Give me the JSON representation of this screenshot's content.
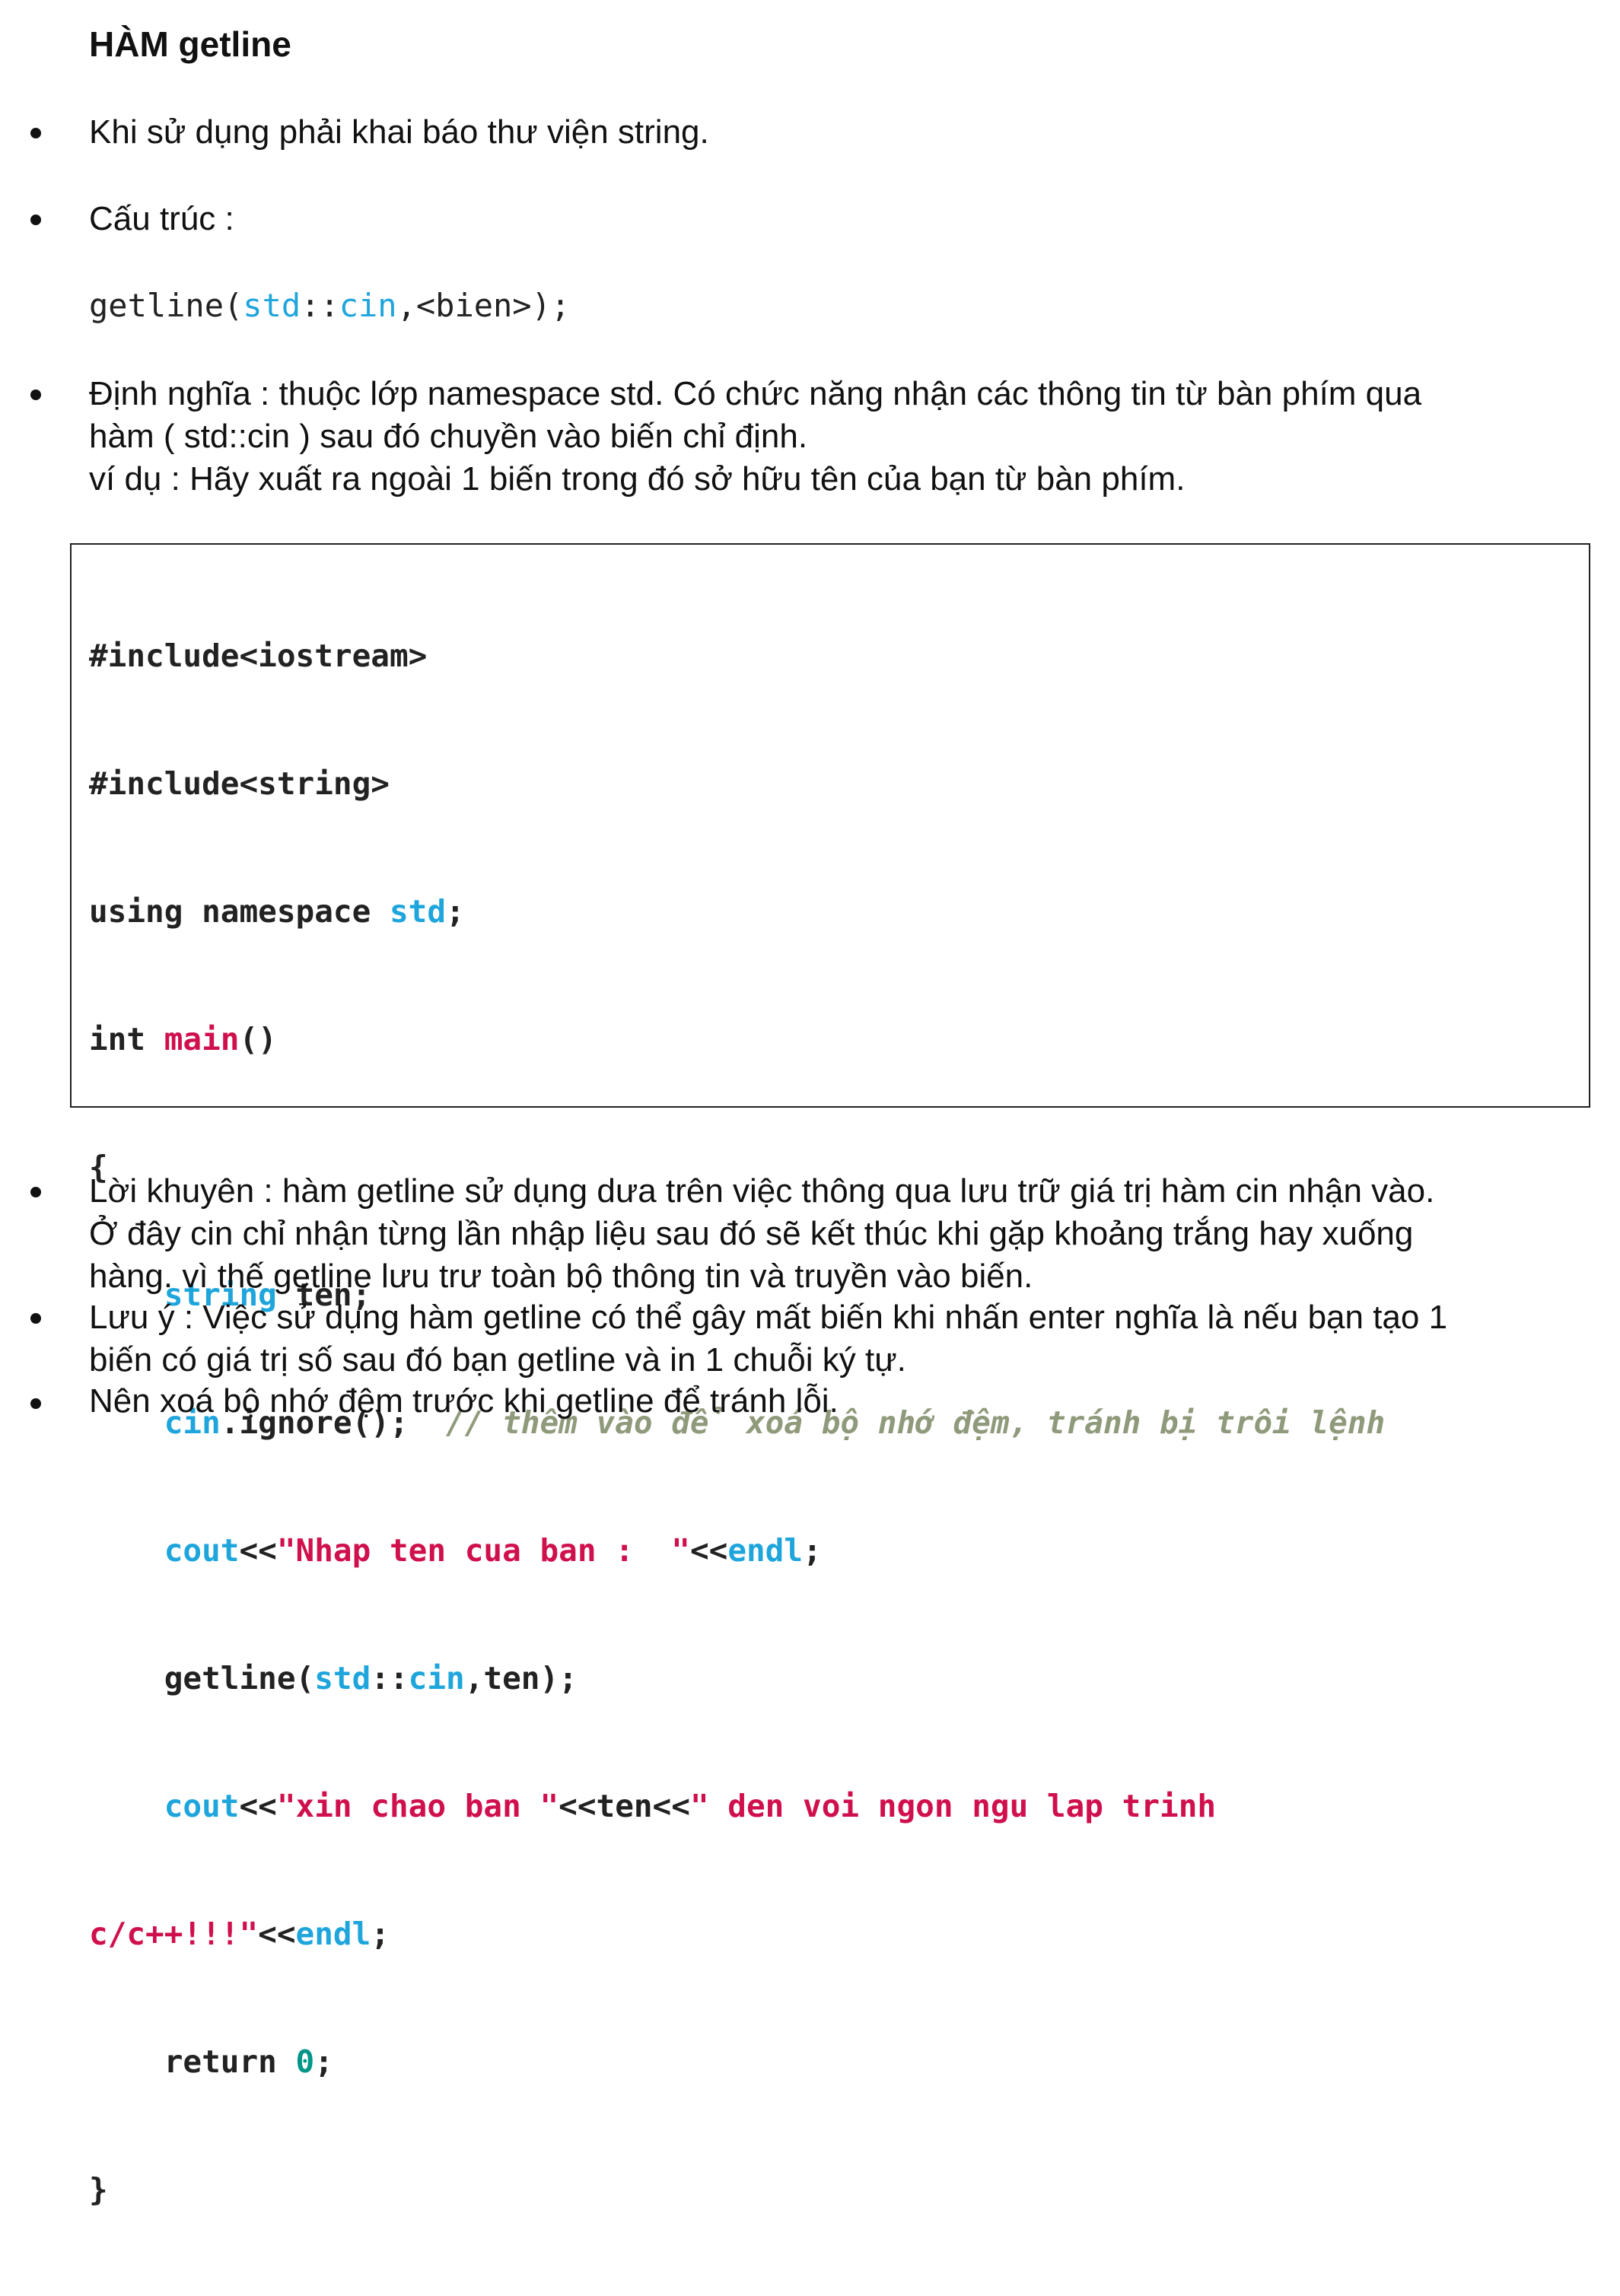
{
  "title": "HÀM getline",
  "bullets": {
    "b1": "Khi sử dụng phải khai báo thư viện string.",
    "b2": "Cấu trúc :",
    "b3_lines": [
      "Định nghĩa : thuộc lớp namespace std. Có chức năng nhận các thông tin từ bàn phím qua",
      "hàm ( std::cin ) sau đó chuyền vào biến chỉ định.",
      "ví dụ : Hãy xuất ra ngoài 1 biến trong đó sở hữu tên của bạn từ bàn phím."
    ],
    "b4_lines": [
      "Lời khuyên : hàm getline sử dụng dưa trên việc thông qua lưu trữ giá trị hàm cin nhận vào.",
      "Ở đây cin chỉ nhận từng lần nhập liệu sau đó sẽ kết thúc khi gặp khoảng trắng hay xuống",
      "hàng. vì thế getline lưu trư toàn bộ thông tin và truyền vào biến."
    ],
    "b5_lines": [
      "Lưu ý : Việc sử dụng hàm getline có thể gây mất biến khi nhấn enter nghĩa là nếu bạn tạo 1",
      "biến có giá trị số sau đó bạn getline và in 1 chuỗi ký tự."
    ],
    "b6": "Nên xoá bộ nhớ đệm trước khi getline để tránh lỗi."
  },
  "syntax": {
    "t1": "getline(",
    "t2": "std",
    "t3": "::",
    "t4": "cin",
    "t5": ",<bien>);"
  },
  "code": {
    "l1": "#include<iostream>",
    "l2": "#include<string>",
    "l3a": "using namespace ",
    "l3b": "std",
    "l3c": ";",
    "l4a": "int ",
    "l4b": "main",
    "l4c": "()",
    "l5": "{",
    "l6a": "    ",
    "l6b": "string",
    "l6c": " ten;",
    "l7a": "    ",
    "l7b": "cin",
    "l7c": ".ignore();  ",
    "l7d": "// thêm vào để xoá bộ nhớ đệm, tránh bị trôi lệnh",
    "l8a": "    ",
    "l8b": "cout",
    "l8c": "<<",
    "l8d": "\"Nhap ten cua ban :  \"",
    "l8e": "<<",
    "l8f": "endl",
    "l8g": ";",
    "l9a": "    getline(",
    "l9b": "std",
    "l9c": "::",
    "l9d": "cin",
    "l9e": ",ten);",
    "l10a": "    ",
    "l10b": "cout",
    "l10c": "<<",
    "l10d": "\"xin chao ban \"",
    "l10e": "<<ten<<",
    "l10f": "\" den voi ngon ngu lap trinh",
    "l11a": "c/c++!!!\"",
    "l11b": "<<",
    "l11c": "endl",
    "l11d": ";",
    "l12a": "    return ",
    "l12b": "0",
    "l12c": ";",
    "l13": "}"
  }
}
